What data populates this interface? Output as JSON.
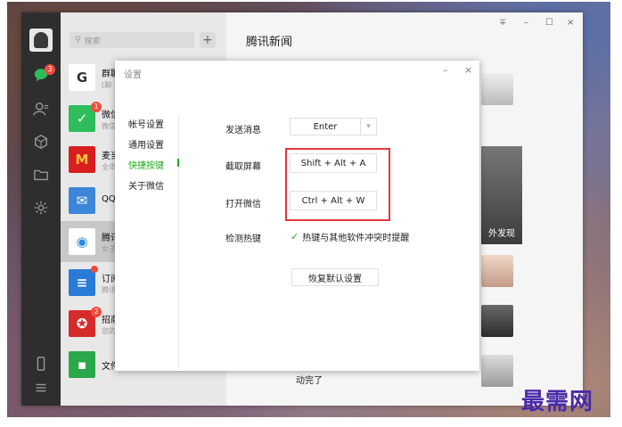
{
  "sidebar": {
    "chat_badge": "3",
    "icons": [
      "chat-icon",
      "contacts-icon",
      "favorites-icon",
      "files-icon",
      "settings-icon",
      "phone-icon",
      "menu-icon"
    ]
  },
  "chat_list": {
    "search_placeholder": "搜索",
    "add_label": "+",
    "items": [
      {
        "name": "群聊",
        "sub": "[聊",
        "avatar_color": "#ffffff",
        "avatar_text": "G"
      },
      {
        "name": "微信",
        "sub": "微信",
        "badge": "1",
        "avatar_color": "#2dbd5a",
        "avatar_text": "✓"
      },
      {
        "name": "麦当",
        "sub": "全华",
        "avatar_color": "#d81e1e",
        "avatar_text": "M"
      },
      {
        "name": "QQ",
        "sub": "",
        "avatar_color": "#3b86d8",
        "avatar_text": "✉"
      },
      {
        "name": "腾讯",
        "sub": "女子",
        "avatar_color": "#ffffff",
        "avatar_text": "◉"
      },
      {
        "name": "订阅",
        "sub": "腾讯",
        "avatar_color": "#2a7ad8",
        "avatar_text": "≡"
      },
      {
        "name": "招商",
        "sub": "您的",
        "badge": "2",
        "avatar_color": "#d52b2b",
        "avatar_text": "✪"
      },
      {
        "name": "文件",
        "sub": "",
        "avatar_color": "#2aa84a",
        "avatar_text": "▪"
      }
    ]
  },
  "news_panel": {
    "title": "腾讯新闻",
    "ctrl_pin": "∓",
    "ctrl_min": "–",
    "ctrl_max": "☐",
    "ctrl_close": "×",
    "img_caption": "外发现",
    "bottom_text": "动完了"
  },
  "dialog": {
    "title": "设置",
    "ctrl_min": "–",
    "ctrl_close": "×",
    "nav": [
      {
        "label": "帐号设置"
      },
      {
        "label": "通用设置"
      },
      {
        "label": "快捷按键"
      },
      {
        "label": "关于微信"
      }
    ],
    "rows": {
      "send_label": "发送消息",
      "send_value": "Enter",
      "screenshot_label": "截取屏幕",
      "screenshot_value": "Shift + Alt + A",
      "open_label": "打开微信",
      "open_value": "Ctrl + Alt + W",
      "detect_label": "检测热键",
      "detect_check": "热键与其他软件冲突时提醒",
      "reset_label": "恢复默认设置"
    }
  },
  "watermark": "最需网",
  "colors": {
    "accent_green": "#1aad19",
    "highlight_red": "#e0393e",
    "sidebar_dark": "#2e2e2e"
  }
}
